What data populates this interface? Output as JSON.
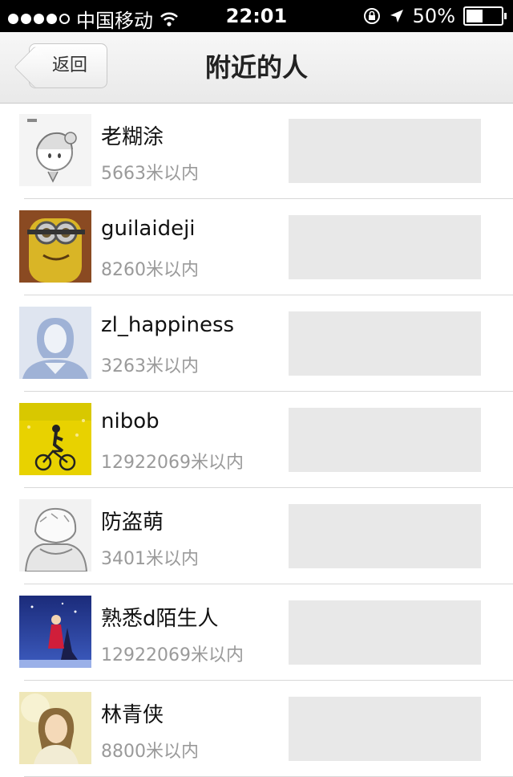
{
  "status_bar": {
    "carrier": "中国移动",
    "time": "22:01",
    "battery": "50%"
  },
  "nav": {
    "back_label": "返回",
    "title": "附近的人"
  },
  "people": [
    {
      "name": "老糊涂",
      "distance": "5663米以内"
    },
    {
      "name": "guilaideji",
      "distance": "8260米以内"
    },
    {
      "name": "zl_happiness",
      "distance": "3263米以内"
    },
    {
      "name": "nibob",
      "distance": "12922069米以内"
    },
    {
      "name": "防盗萌",
      "distance": "3401米以内"
    },
    {
      "name": "熟悉d陌生人",
      "distance": "12922069米以内"
    },
    {
      "name": "林青侠",
      "distance": "8800米以内"
    }
  ]
}
